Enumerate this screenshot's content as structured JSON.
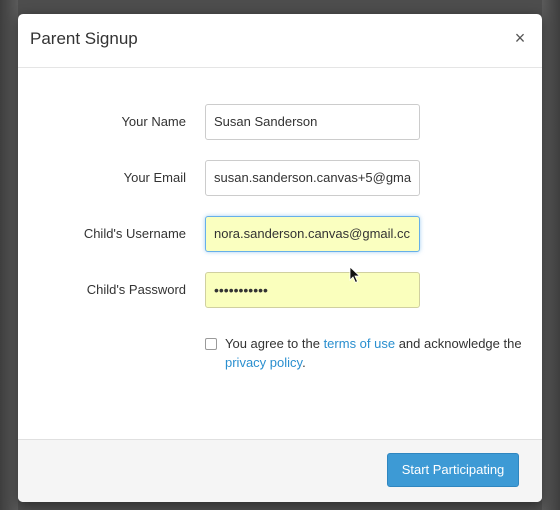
{
  "dialog": {
    "title": "Parent Signup",
    "close_symbol": "×"
  },
  "form": {
    "name": {
      "label": "Your Name",
      "value": "Susan Sanderson"
    },
    "email": {
      "label": "Your Email",
      "value": "susan.sanderson.canvas+5@gma"
    },
    "child_username": {
      "label": "Child's Username",
      "value": "nora.sanderson.canvas@gmail.cc"
    },
    "child_password": {
      "label": "Child's Password",
      "masked_value": "•••••••••••"
    }
  },
  "agreement": {
    "prefix": "You agree to the ",
    "terms_link": "terms of use",
    "middle": " and acknowledge the ",
    "privacy_link": "privacy policy",
    "suffix": ".",
    "checked": false
  },
  "footer": {
    "submit_label": "Start Participating"
  },
  "colors": {
    "primary_button": "#3d9ad5",
    "link": "#2a8fcf",
    "autofill_background": "#faffbd",
    "focus_border": "#66afe9"
  },
  "icons": {
    "close": "close-icon",
    "cursor": "mouse-pointer-icon"
  }
}
